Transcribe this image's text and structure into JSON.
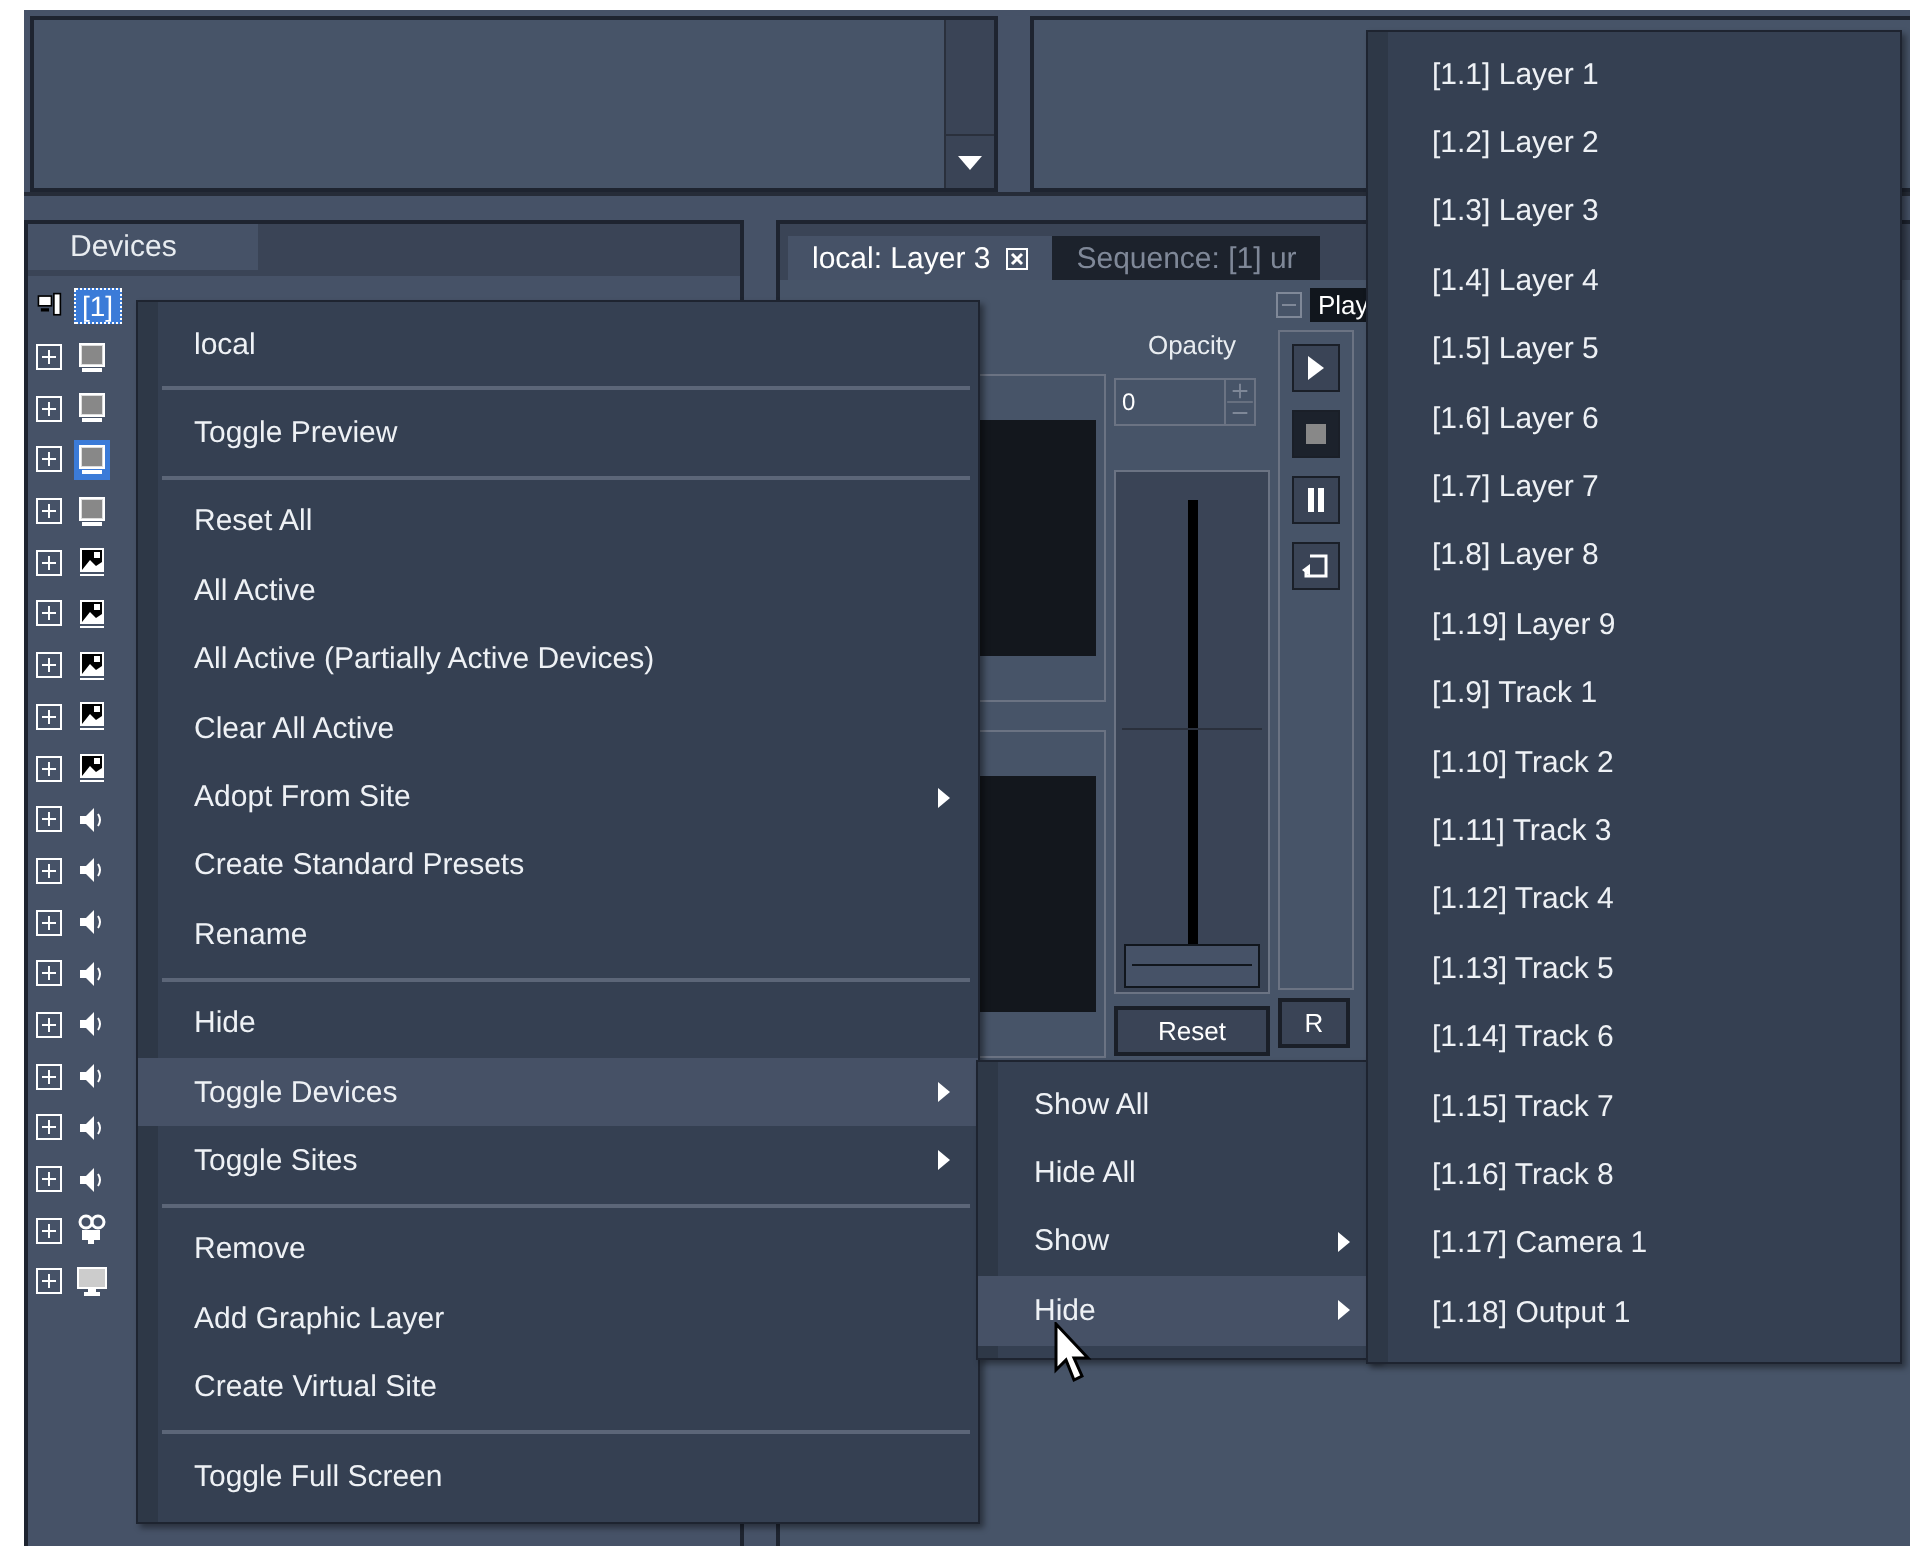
{
  "devices": {
    "title": "Devices",
    "items": [
      {
        "kind": "computer",
        "label": "[1]",
        "selected": true
      },
      {
        "kind": "layer",
        "selected": false
      },
      {
        "kind": "layer",
        "selected": false
      },
      {
        "kind": "layer",
        "selected": true
      },
      {
        "kind": "layer",
        "selected": false
      },
      {
        "kind": "image",
        "selected": false
      },
      {
        "kind": "image",
        "selected": false
      },
      {
        "kind": "image",
        "selected": false
      },
      {
        "kind": "image",
        "selected": false
      },
      {
        "kind": "image",
        "selected": false
      },
      {
        "kind": "audio",
        "selected": false
      },
      {
        "kind": "audio",
        "selected": false
      },
      {
        "kind": "audio",
        "selected": false
      },
      {
        "kind": "audio",
        "selected": false
      },
      {
        "kind": "audio",
        "selected": false
      },
      {
        "kind": "audio",
        "selected": false
      },
      {
        "kind": "audio",
        "selected": false
      },
      {
        "kind": "audio",
        "selected": false
      },
      {
        "kind": "camera",
        "selected": false
      },
      {
        "kind": "output",
        "selected": false
      }
    ]
  },
  "layer_panel": {
    "tabs": [
      {
        "label": "local: Layer 3",
        "selected": true,
        "closable": true
      },
      {
        "label": "Sequence: [1] ur",
        "selected": false,
        "closable": false
      }
    ],
    "play_button": "Play",
    "opacity": {
      "label": "Opacity",
      "value": "0",
      "level": 0
    },
    "reset_button": "Reset",
    "r_button": "R"
  },
  "context_menu": {
    "items": [
      {
        "kind": "item",
        "label": "local",
        "selected": false
      },
      {
        "kind": "separator"
      },
      {
        "kind": "item",
        "label": "Toggle Preview",
        "selected": false
      },
      {
        "kind": "separator"
      },
      {
        "kind": "item",
        "label": "Reset All",
        "selected": false
      },
      {
        "kind": "item",
        "label": "All Active",
        "selected": false
      },
      {
        "kind": "item",
        "label": "All Active (Partially Active Devices)",
        "selected": false
      },
      {
        "kind": "item",
        "label": "Clear All Active",
        "selected": false
      },
      {
        "kind": "submenu",
        "label": "Adopt From Site",
        "selected": false
      },
      {
        "kind": "item",
        "label": "Create Standard Presets",
        "selected": false
      },
      {
        "kind": "item",
        "label": "Rename",
        "selected": false
      },
      {
        "kind": "separator"
      },
      {
        "kind": "item",
        "label": "Hide",
        "selected": false
      },
      {
        "kind": "submenu",
        "label": "Toggle Devices",
        "selected": true
      },
      {
        "kind": "submenu",
        "label": "Toggle Sites",
        "selected": false
      },
      {
        "kind": "separator"
      },
      {
        "kind": "item",
        "label": "Remove",
        "selected": false
      },
      {
        "kind": "item",
        "label": "Add Graphic Layer",
        "selected": false
      },
      {
        "kind": "item",
        "label": "Create Virtual Site",
        "selected": false
      },
      {
        "kind": "separator"
      },
      {
        "kind": "item",
        "label": "Toggle Full Screen",
        "selected": false
      }
    ]
  },
  "submenu": {
    "items": [
      {
        "kind": "item",
        "label": "Show All",
        "selected": false
      },
      {
        "kind": "item",
        "label": "Hide All",
        "selected": false
      },
      {
        "kind": "submenu",
        "label": "Show",
        "selected": false
      },
      {
        "kind": "submenu",
        "label": "Hide",
        "selected": true
      }
    ]
  },
  "hide_menu": {
    "items": [
      "[1.1] Layer 1",
      "[1.2] Layer 2",
      "[1.3] Layer 3",
      "[1.4] Layer 4",
      "[1.5] Layer 5",
      "[1.6] Layer 6",
      "[1.7] Layer 7",
      "[1.8] Layer 8",
      "[1.19] Layer 9",
      "[1.9] Track 1",
      "[1.10] Track 2",
      "[1.11] Track 3",
      "[1.12] Track 4",
      "[1.13] Track 5",
      "[1.14] Track 6",
      "[1.15] Track 7",
      "[1.16] Track 8",
      "[1.17] Camera 1",
      "[1.18] Output 1"
    ]
  }
}
